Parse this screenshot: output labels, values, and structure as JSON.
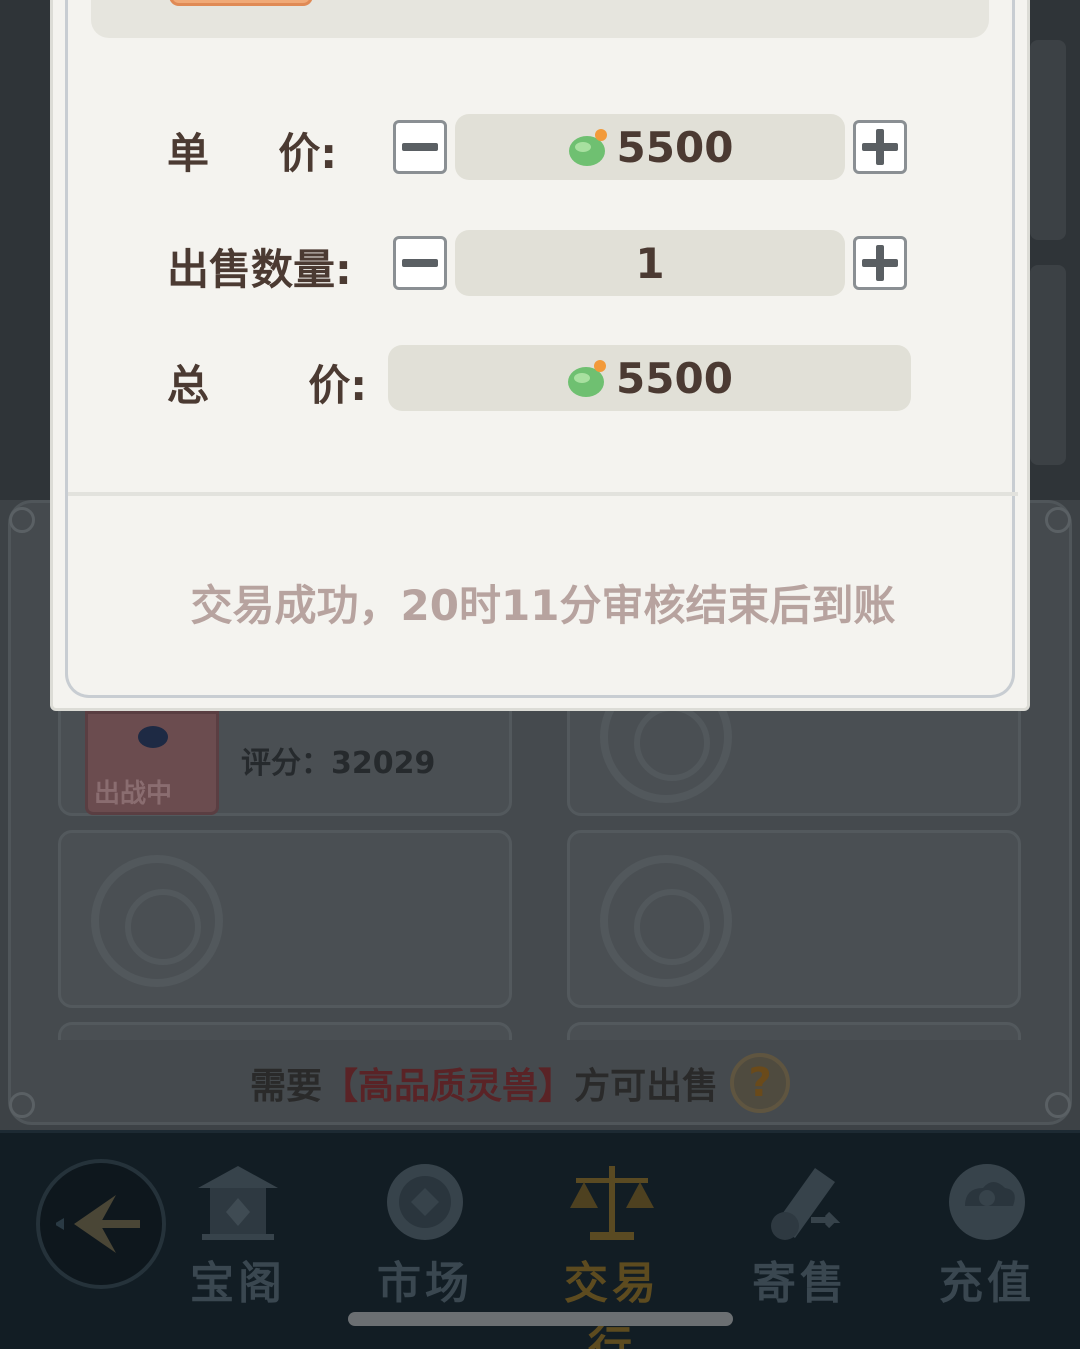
{
  "dialog": {
    "rows": [
      {
        "label_parts": [
          "单",
          "价:"
        ],
        "value": "5500",
        "currency_icon": "jade-coin-icon",
        "has_stepper": true
      },
      {
        "label_parts": [
          "出售数量:"
        ],
        "value": "1",
        "has_stepper": true
      },
      {
        "label_parts": [
          "总",
          "价:"
        ],
        "value": "5500",
        "currency_icon": "jade-coin-icon",
        "has_stepper": false
      }
    ],
    "status_message": "交易成功，20时11分审核结束后到账"
  },
  "pet_card": {
    "tag": "出战中",
    "score_text": "评分：32029"
  },
  "hint": {
    "prefix": "需要",
    "bracket_open": "【",
    "highlight": "高品质灵兽",
    "bracket_close": "】",
    "suffix": "方可出售",
    "help_symbol": "?"
  },
  "bottom_nav": {
    "items": [
      {
        "label": "宝阁",
        "icon": "pavilion-icon"
      },
      {
        "label": "市场",
        "icon": "coin-icon"
      },
      {
        "label": "交易行",
        "icon": "scale-icon",
        "active": true
      },
      {
        "label": "寄售",
        "icon": "scroll-icon"
      },
      {
        "label": "充值",
        "icon": "cloud-icon"
      }
    ]
  },
  "colors": {
    "dialog_bg": "#f4f3ef",
    "label_text": "#4b3a32",
    "status_text": "#b7a39f",
    "active_nav": "#5d4b1f",
    "nav_bg": "#121d24"
  }
}
